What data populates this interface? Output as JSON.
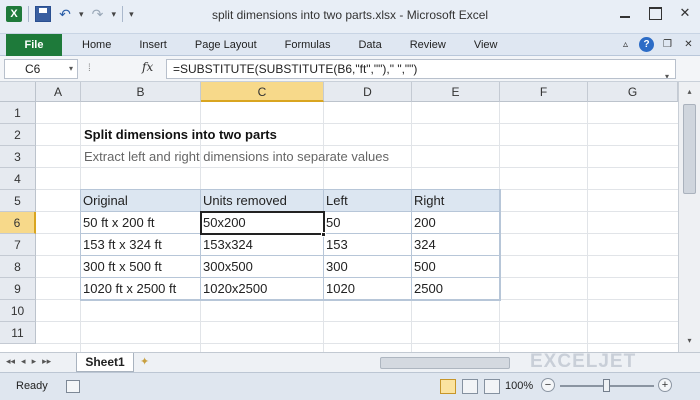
{
  "window": {
    "title": "split dimensions into two parts.xlsx - Microsoft Excel",
    "app_icon": "X",
    "undo_glyph": "↶",
    "redo_glyph": "↷",
    "qat_dropdown": "▾",
    "minimize": "",
    "maximize": "",
    "close": "✕"
  },
  "ribbon": {
    "file_tab": "File",
    "tabs": [
      "Home",
      "Insert",
      "Page Layout",
      "Formulas",
      "Data",
      "Review",
      "View"
    ],
    "right_icons": {
      "minimize_ribbon": "▵",
      "help": "?",
      "restore": "❐",
      "close": "✕"
    }
  },
  "formula_bar": {
    "name_box": "C6",
    "name_box_dropdown": "▾",
    "grip": "⁞",
    "fx": "fx",
    "formula": "=SUBSTITUTE(SUBSTITUTE(B6,\"ft\",\"\"),\" \",\"\")",
    "expand": "▾"
  },
  "grid": {
    "columns": [
      "A",
      "B",
      "C",
      "D",
      "E",
      "F",
      "G"
    ],
    "active_column": "C",
    "rows": [
      "1",
      "2",
      "3",
      "4",
      "5",
      "6",
      "7",
      "8",
      "9",
      "10",
      "11"
    ],
    "active_row": "6"
  },
  "sheet": {
    "heading": "Split dimensions into two parts",
    "subheading": "Extract left and right dimensions into separate values",
    "table": {
      "headers": [
        "Original",
        "Units removed",
        "Left",
        "Right"
      ],
      "rows": [
        [
          "50 ft x 200 ft",
          "50x200",
          "50",
          "200"
        ],
        [
          "153 ft x 324 ft",
          "153x324",
          "153",
          "324"
        ],
        [
          "300 ft x 500 ft",
          "300x500",
          "300",
          "500"
        ],
        [
          "1020 ft x 2500 ft",
          "1020x2500",
          "1020",
          "2500"
        ]
      ]
    },
    "selected_cell": "C6"
  },
  "sheet_tabs": {
    "nav": [
      "◂◂",
      "◂",
      "▸",
      "▸▸"
    ],
    "active": "Sheet1",
    "new_sheet_glyph": "✦",
    "watermark": "EXCELJET"
  },
  "status_bar": {
    "ready": "Ready",
    "zoom": "100%",
    "zoom_minus": "−",
    "zoom_plus": "+",
    "zoom_level": 100
  },
  "scroll": {
    "up": "▴",
    "down": "▾"
  }
}
